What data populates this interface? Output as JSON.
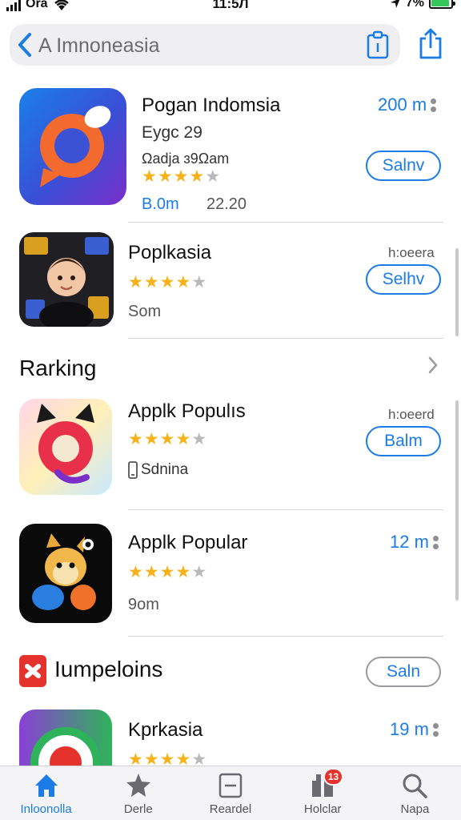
{
  "status_bar": {
    "carrier": "Ora",
    "time": "11:5Л",
    "battery_text": "7%",
    "battery_level": 0.9
  },
  "nav": {
    "title": "A Imnoneasia",
    "back_icon": "chevron-left-icon",
    "clipboard_icon": "clipboard-icon",
    "share_icon": "share-icon"
  },
  "apps": [
    {
      "name": "Pogan Indomsia",
      "subtitle": "Eygc 29",
      "meta": "Ωadja ɜ9Ωam",
      "rating": 4,
      "size": "B.0m",
      "extra": "22.20",
      "right_value": "200 m",
      "button": "Salnv"
    },
    {
      "name": "Poplkasia",
      "rating": 4,
      "size": "Som",
      "right_label": "h:oeera",
      "button": "Selhv"
    }
  ],
  "ranking": {
    "title": "Rarking",
    "chevron_icon": "chevron-right-icon",
    "apps": [
      {
        "name": "Applk Populıs",
        "rating": 4,
        "developer": "Sdnina",
        "right_label": "h:oeerd",
        "button": "Balm"
      },
      {
        "name": "Applk Popular",
        "rating": 4,
        "size": "9om",
        "right_value": "12 m"
      }
    ]
  },
  "section2": {
    "title": "Iumpeloins",
    "button": "Saln",
    "apps": [
      {
        "name": "Kprkasia",
        "rating": 4,
        "right_value": "19 m"
      }
    ]
  },
  "tabs": [
    {
      "label": "Inloonolla",
      "icon": "home-icon",
      "active": true
    },
    {
      "label": "Derle",
      "icon": "star-icon",
      "active": false
    },
    {
      "label": "Reardel",
      "icon": "document-icon",
      "active": false
    },
    {
      "label": "Holclar",
      "icon": "gift-icon",
      "active": false,
      "badge": "13"
    },
    {
      "label": "Napa",
      "icon": "search-icon",
      "active": false
    }
  ],
  "colors": {
    "accent": "#1b7be7",
    "star": "#f5b21a",
    "badge": "#e5322d"
  }
}
